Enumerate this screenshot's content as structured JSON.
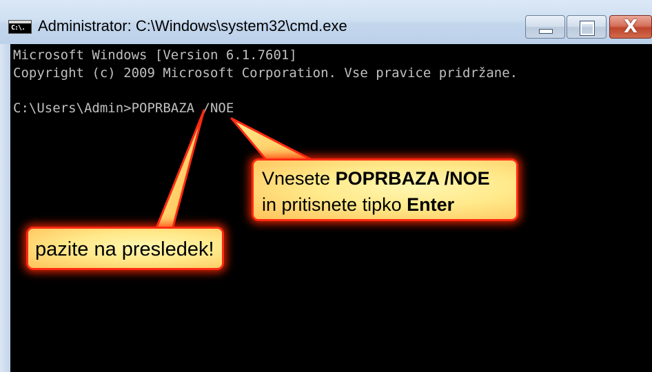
{
  "window": {
    "title": "Administrator: C:\\Windows\\system32\\cmd.exe",
    "icon_label": "C:\\.",
    "controls": {
      "minimize_icon": "minimize-icon",
      "maximize_icon": "maximize-icon",
      "close_glyph": "X"
    }
  },
  "console": {
    "line1": "Microsoft Windows [Version 6.1.7601]",
    "line2": "Copyright (c) 2009 Microsoft Corporation. Vse pravice pridržane.",
    "prompt_line": "C:\\Users\\Admin>POPRBAZA /NOE"
  },
  "callouts": {
    "enter": {
      "text1": "Vnesete ",
      "command": "POPRBAZA  /NOE",
      "text2": "in pritisnete tipko ",
      "key": "Enter"
    },
    "space": {
      "text": "pazite na presledek!"
    }
  },
  "colors": {
    "console_bg": "#000000",
    "console_fg": "#c0c0c0",
    "callout_border": "#ff2a12",
    "callout_fill": "#ffe98a"
  }
}
